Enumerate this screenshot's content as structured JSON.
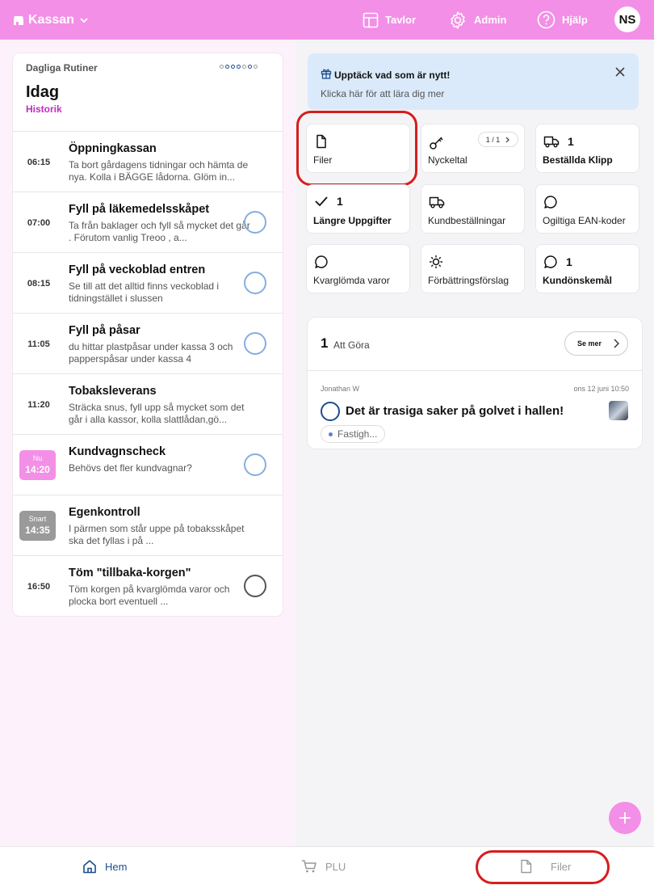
{
  "topbar": {
    "brand": "Kassan",
    "boards_label": "Tavlor",
    "admin_label": "Admin",
    "help_label": "Hjälp",
    "avatar_initials": "NS",
    "bg_color": "#f38fe6"
  },
  "routines": {
    "heading_small": "Dagliga Rutiner",
    "title": "Idag",
    "history_link": "Historik",
    "items": [
      {
        "time": "06:15",
        "title": "Öppningkassan",
        "desc": "Ta bort gårdagens tidningar och hämta de nya. Kolla i BÄGGE lådorna. Glöm in..."
      },
      {
        "time": "07:00",
        "title": "Fyll på läkemedelsskåpet",
        "desc": "Ta från baklager och fyll så mycket det går . Förutom vanlig Treoo , a..."
      },
      {
        "time": "08:15",
        "title": "Fyll på veckoblad entren",
        "desc": "Se till att det alltid finns veckoblad i tidningstället i slussen"
      },
      {
        "time": "11:05",
        "title": "Fyll på påsar",
        "desc": "du hittar plastpåsar under kassa 3 och papperspåsar under kassa 4"
      },
      {
        "time": "11:20",
        "title": "Tobaksleverans",
        "desc": "Sträcka snus, fyll upp så mycket som det går i alla kassor, kolla slattlådan,gö..."
      },
      {
        "badge_top": "Nu",
        "time": "14:20",
        "title": "Kundvagnscheck",
        "desc": "Behövs det fler kundvagnar?"
      },
      {
        "badge_top": "Snart",
        "time": "14:35",
        "title": "Egenkontroll",
        "desc": "I pärmen som står uppe på tobaksskåpet ska det fyllas i på ..."
      },
      {
        "time": "16:50",
        "title": "Töm \"tillbaka-korgen\"",
        "desc": "Töm korgen på kvarglömda varor och plocka bort eventuell ..."
      }
    ]
  },
  "news": {
    "title": "Upptäck vad som är nytt!",
    "subtitle": "Klicka här för att lära dig mer"
  },
  "tiles": {
    "files": {
      "label": "Filer"
    },
    "kpi": {
      "label": "Nyckeltal",
      "pager": "1 / 1"
    },
    "ordered_clips": {
      "count": "1",
      "label": "Beställda Klipp"
    },
    "longer_tasks": {
      "count": "1",
      "label": "Längre Uppgifter"
    },
    "customer_orders": {
      "label": "Kundbeställningar"
    },
    "invalid_ean": {
      "label": "Ogiltiga EAN-koder"
    },
    "forgotten_items": {
      "label": "Kvarglömda varor"
    },
    "suggestions": {
      "label": "Förbättringsförslag"
    },
    "customer_requests": {
      "count": "1",
      "label": "Kundönskemål"
    }
  },
  "todo": {
    "count": "1",
    "label": "Att Göra",
    "see_more": "Se mer",
    "task": {
      "author": "Jonathan W",
      "date": "ons 12 juni 10:50",
      "title": "Det är trasiga saker på golvet i hallen!",
      "tag": "Fastigh..."
    }
  },
  "bottom_nav": {
    "home": "Hem",
    "plu": "PLU",
    "files": "Filer"
  }
}
